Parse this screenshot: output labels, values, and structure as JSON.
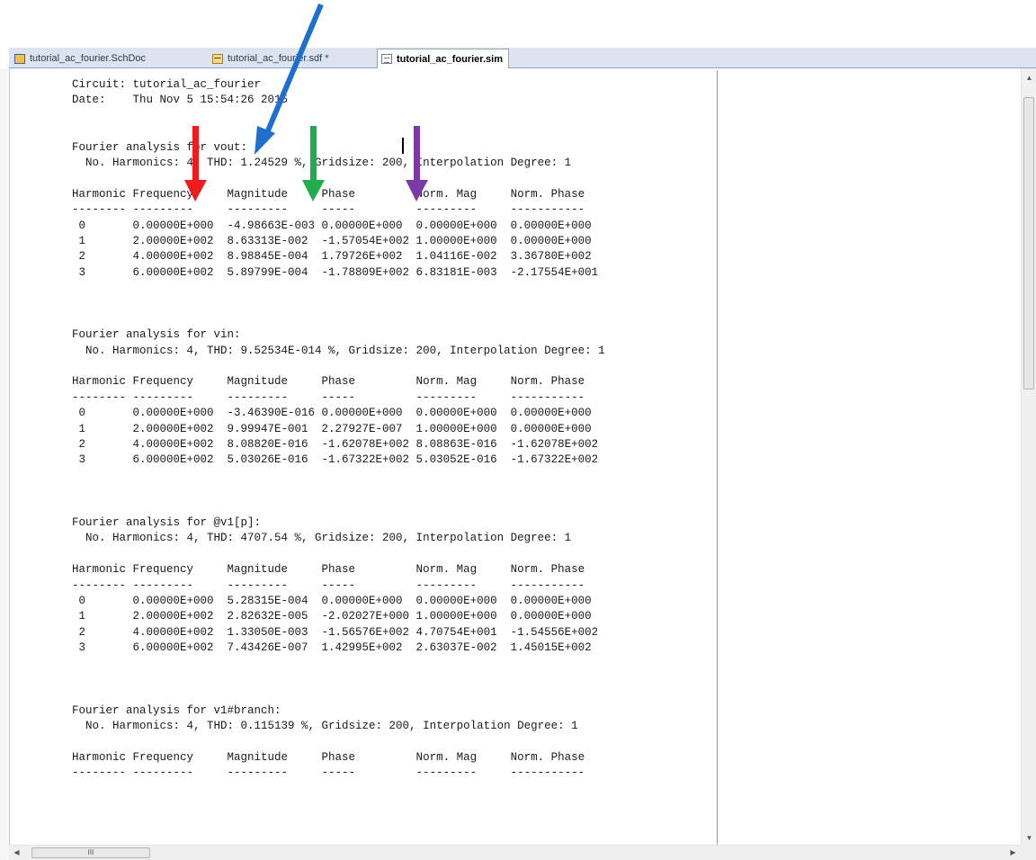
{
  "tabs": [
    {
      "label": "tutorial_ac_fourier.SchDoc",
      "icon": "schematic-doc-icon",
      "active": false
    },
    {
      "label": "tutorial_ac_fourier.sdf *",
      "icon": "waveform-doc-icon",
      "active": false
    },
    {
      "label": "tutorial_ac_fourier.sim",
      "icon": "text-doc-icon",
      "active": true
    }
  ],
  "lines": [
    "Circuit: tutorial_ac_fourier",
    "Date:    Thu Nov 5 15:54:26 2015",
    "",
    "",
    "Fourier analysis for vout:",
    "  No. Harmonics: 4, THD: 1.24529 %, Gridsize: 200, Interpolation Degree: 1",
    "",
    "Harmonic Frequency     Magnitude     Phase         Norm. Mag     Norm. Phase",
    "-------- ---------     ---------     -----         ---------     -----------",
    " 0       0.00000E+000  -4.98663E-003 0.00000E+000  0.00000E+000  0.00000E+000",
    " 1       2.00000E+002  8.63313E-002  -1.57054E+002 1.00000E+000  0.00000E+000",
    " 2       4.00000E+002  8.98845E-004  1.79726E+002  1.04116E-002  3.36780E+002",
    " 3       6.00000E+002  5.89799E-004  -1.78809E+002 6.83181E-003  -2.17554E+001",
    "",
    "",
    "",
    "Fourier analysis for vin:",
    "  No. Harmonics: 4, THD: 9.52534E-014 %, Gridsize: 200, Interpolation Degree: 1",
    "",
    "Harmonic Frequency     Magnitude     Phase         Norm. Mag     Norm. Phase",
    "-------- ---------     ---------     -----         ---------     -----------",
    " 0       0.00000E+000  -3.46390E-016 0.00000E+000  0.00000E+000  0.00000E+000",
    " 1       2.00000E+002  9.99947E-001  2.27927E-007  1.00000E+000  0.00000E+000",
    " 2       4.00000E+002  8.08820E-016  -1.62078E+002 8.08863E-016  -1.62078E+002",
    " 3       6.00000E+002  5.03026E-016  -1.67322E+002 5.03052E-016  -1.67322E+002",
    "",
    "",
    "",
    "Fourier analysis for @v1[p]:",
    "  No. Harmonics: 4, THD: 4707.54 %, Gridsize: 200, Interpolation Degree: 1",
    "",
    "Harmonic Frequency     Magnitude     Phase         Norm. Mag     Norm. Phase",
    "-------- ---------     ---------     -----         ---------     -----------",
    " 0       0.00000E+000  5.28315E-004  0.00000E+000  0.00000E+000  0.00000E+000",
    " 1       2.00000E+002  2.82632E-005  -2.02027E+000 1.00000E+000  0.00000E+000",
    " 2       4.00000E+002  1.33050E-003  -1.56576E+002 4.70754E+001  -1.54556E+002",
    " 3       6.00000E+002  7.43426E-007  1.42995E+002  2.63037E-002  1.45015E+002",
    "",
    "",
    "",
    "Fourier analysis for v1#branch:",
    "  No. Harmonics: 4, THD: 0.115139 %, Gridsize: 200, Interpolation Degree: 1",
    "",
    "Harmonic Frequency     Magnitude     Phase         Norm. Mag     Norm. Phase",
    "-------- ---------     ---------     -----         ---------     -----------"
  ],
  "annotations": {
    "arrows": [
      {
        "color": "#1e6fd0",
        "points_to": "vout"
      },
      {
        "color": "#ee1c1c",
        "points_to": "Frequency"
      },
      {
        "color": "#1fae4b",
        "points_to": "Magnitude"
      },
      {
        "color": "#7a3aa8",
        "points_to": "Phase"
      }
    ]
  },
  "scrollbar": {
    "h_thumb_glyph": "III"
  }
}
